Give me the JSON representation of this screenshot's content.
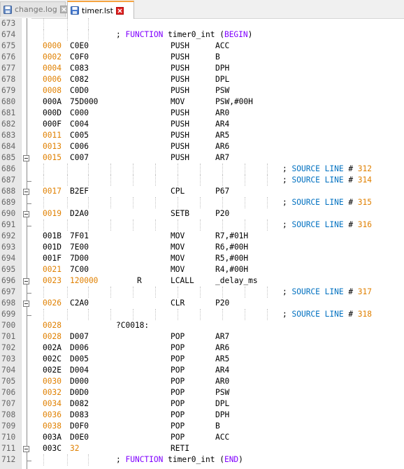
{
  "tabs": [
    {
      "label": "change.log",
      "active": false,
      "icon": "save-icon"
    },
    {
      "label": "timer.lst",
      "active": true,
      "icon": "save-icon"
    }
  ],
  "colors": {
    "address_orange": "#e08000",
    "keyword_purple": "#8000ff",
    "comment_blue": "#0070c0",
    "active_tab_accent": "#f6a340",
    "close_red": "#e02020"
  },
  "lines": [
    {
      "n": "673"
    },
    {
      "n": "674"
    },
    {
      "n": "675",
      "addr": "0000",
      "code": "C0E0",
      "mn": "PUSH",
      "op": "ACC",
      "orange": true
    },
    {
      "n": "676",
      "addr": "0002",
      "code": "C0F0",
      "mn": "PUSH",
      "op": "B",
      "orange": true
    },
    {
      "n": "677",
      "addr": "0004",
      "code": "C083",
      "mn": "PUSH",
      "op": "DPH",
      "orange": true
    },
    {
      "n": "678",
      "addr": "0006",
      "code": "C082",
      "mn": "PUSH",
      "op": "DPL",
      "orange": true
    },
    {
      "n": "679",
      "addr": "0008",
      "code": "C0D0",
      "mn": "PUSH",
      "op": "PSW",
      "orange": true
    },
    {
      "n": "680",
      "addr": "000A",
      "code": "75D000",
      "mn": "MOV",
      "op": "PSW,#00H"
    },
    {
      "n": "681",
      "addr": "000D",
      "code": "C000",
      "mn": "PUSH",
      "op": "AR0"
    },
    {
      "n": "682",
      "addr": "000F",
      "code": "C004",
      "mn": "PUSH",
      "op": "AR4"
    },
    {
      "n": "683",
      "addr": "0011",
      "code": "C005",
      "mn": "PUSH",
      "op": "AR5",
      "orange": true
    },
    {
      "n": "684",
      "addr": "0013",
      "code": "C006",
      "mn": "PUSH",
      "op": "AR6",
      "orange": true
    },
    {
      "n": "685",
      "addr": "0015",
      "code": "C007",
      "mn": "PUSH",
      "op": "AR7",
      "orange": true,
      "fold": "open"
    },
    {
      "n": "686",
      "src": "312"
    },
    {
      "n": "687",
      "src": "314",
      "fold": "end"
    },
    {
      "n": "688",
      "addr": "0017",
      "code": "B2EF",
      "mn": "CPL",
      "op": "P67",
      "orange": true,
      "fold": "open"
    },
    {
      "n": "689",
      "src": "315",
      "fold": "end"
    },
    {
      "n": "690",
      "addr": "0019",
      "code": "D2A0",
      "mn": "SETB",
      "op": "P20",
      "orange": true,
      "fold": "open"
    },
    {
      "n": "691",
      "src": "316",
      "fold": "end"
    },
    {
      "n": "692",
      "addr": "001B",
      "code": "7F01",
      "mn": "MOV",
      "op": "R7,#01H"
    },
    {
      "n": "693",
      "addr": "001D",
      "code": "7E00",
      "mn": "MOV",
      "op": "R6,#00H"
    },
    {
      "n": "694",
      "addr": "001F",
      "code": "7D00",
      "mn": "MOV",
      "op": "R5,#00H"
    },
    {
      "n": "695",
      "addr": "0021",
      "code": "7C00",
      "mn": "MOV",
      "op": "R4,#00H",
      "orange": true
    },
    {
      "n": "696",
      "addr": "0023",
      "code": "120000",
      "flag": "R",
      "mn": "LCALL",
      "op": "_delay_ms",
      "orange": true,
      "codeorange": true,
      "fold": "open"
    },
    {
      "n": "697",
      "src": "317",
      "fold": "end"
    },
    {
      "n": "698",
      "addr": "0026",
      "code": "C2A0",
      "mn": "CLR",
      "op": "P20",
      "orange": true,
      "fold": "open"
    },
    {
      "n": "699",
      "src": "318",
      "fold": "end"
    },
    {
      "n": "700",
      "addr": "0028",
      "label": "?C0018:",
      "orange": true
    },
    {
      "n": "701",
      "addr": "0028",
      "code": "D007",
      "mn": "POP",
      "op": "AR7",
      "orange": true
    },
    {
      "n": "702",
      "addr": "002A",
      "code": "D006",
      "mn": "POP",
      "op": "AR6"
    },
    {
      "n": "703",
      "addr": "002C",
      "code": "D005",
      "mn": "POP",
      "op": "AR5"
    },
    {
      "n": "704",
      "addr": "002E",
      "code": "D004",
      "mn": "POP",
      "op": "AR4"
    },
    {
      "n": "705",
      "addr": "0030",
      "code": "D000",
      "mn": "POP",
      "op": "AR0",
      "orange": true
    },
    {
      "n": "706",
      "addr": "0032",
      "code": "D0D0",
      "mn": "POP",
      "op": "PSW",
      "orange": true
    },
    {
      "n": "707",
      "addr": "0034",
      "code": "D082",
      "mn": "POP",
      "op": "DPL",
      "orange": true
    },
    {
      "n": "708",
      "addr": "0036",
      "code": "D083",
      "mn": "POP",
      "op": "DPH",
      "orange": true
    },
    {
      "n": "709",
      "addr": "0038",
      "code": "D0F0",
      "mn": "POP",
      "op": "B",
      "orange": true
    },
    {
      "n": "710",
      "addr": "003A",
      "code": "D0E0",
      "mn": "POP",
      "op": "ACC"
    },
    {
      "n": "711",
      "addr": "003C",
      "code": "32",
      "mn": "RETI",
      "codeorange": true,
      "fold": "open"
    },
    {
      "n": "712",
      "fold": "end"
    }
  ],
  "function_begin": {
    "prefix": "; ",
    "kw": "FUNCTION",
    "name": " timer0_int ",
    "paren_open": "(",
    "tag": "BEGIN",
    "paren_close": ")"
  },
  "function_end": {
    "prefix": "; ",
    "kw": "FUNCTION",
    "name": " timer0_int ",
    "paren_open": "(",
    "tag": "END",
    "paren_close": ")"
  },
  "source_line": {
    "prefix": "; ",
    "text": "SOURCE LINE",
    "hash": " # "
  }
}
